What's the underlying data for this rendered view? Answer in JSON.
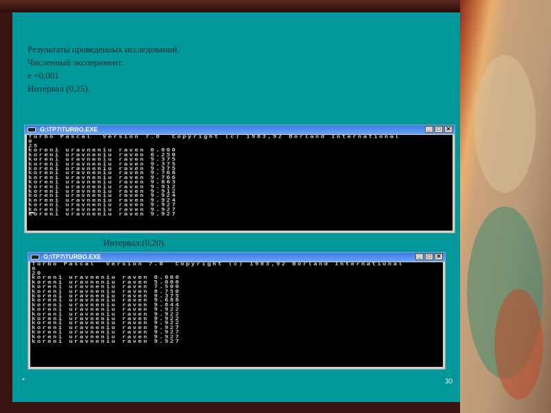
{
  "slide": {
    "heading_lines": [
      "Результаты проведенных исследований.",
      "Численный эксперимент.",
      "e =0,001",
      "Интервал (0,25)."
    ],
    "caption2": "Интервал:(0,20).",
    "footer_mark": "*",
    "page_number": "30"
  },
  "windows": [
    {
      "title": "G:\\TP7\\TURBO.EXE",
      "lines": [
        "Turbo Pascal  Version 7.0  Copyright (c) 1983,92 Borland International",
        "0",
        "25",
        "koreni uravneniu raven 0.000",
        "koreni uravneniu raven 6.250",
        "koreni uravneniu raven 9.375",
        "koreni uravneniu raven 9.375",
        "koreni uravneniu raven 9.375",
        "koreni uravneniu raven 9.766",
        "koreni uravneniu raven 9.766",
        "koreni uravneniu raven 9.863",
        "koreni uravneniu raven 9.912",
        "koreni uravneniu raven 9.912",
        "koreni uravneniu raven 9.924",
        "koreni uravneniu raven 9.924",
        "koreni uravneniu raven 9.927",
        "koreni uravneniu raven 9.927",
        "koreni uravneniu raven 9.927"
      ]
    },
    {
      "title": "G:\\TP7\\TURBO.EXE",
      "lines": [
        "Turbo Pascal  Version 7.0  Copyright (c) 1983,92 Borland International",
        "0",
        "20",
        "koreni uravneniu raven 0.000",
        "koreni uravneniu raven 5.000",
        "koreni uravneniu raven 7.500",
        "koreni uravneniu raven 8.750",
        "koreni uravneniu raven 9.375",
        "koreni uravneniu raven 9.688",
        "koreni uravneniu raven 9.844",
        "koreni uravneniu raven 9.922",
        "koreni uravneniu raven 9.922",
        "koreni uravneniu raven 9.922",
        "koreni uravneniu raven 9.922",
        "koreni uravneniu raven 9.927",
        "koreni uravneniu raven 9.927",
        "koreni uravneniu raven 9.927",
        "koreni uravneniu raven 9.927"
      ]
    }
  ],
  "window_buttons": {
    "minimize": "_",
    "maximize": "□",
    "close": "✕"
  }
}
